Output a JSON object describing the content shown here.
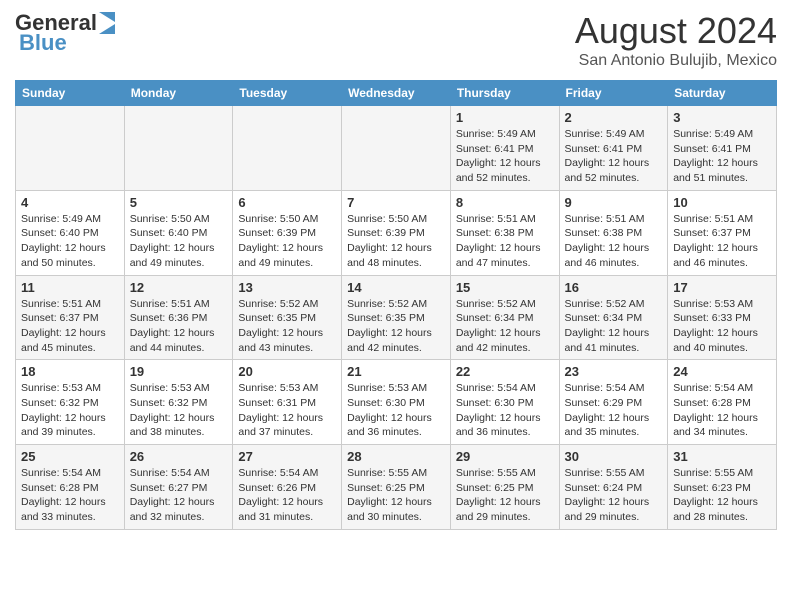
{
  "header": {
    "logo_text1": "General",
    "logo_text2": "Blue",
    "title": "August 2024",
    "subtitle": "San Antonio Bulujib, Mexico"
  },
  "days_of_week": [
    "Sunday",
    "Monday",
    "Tuesday",
    "Wednesday",
    "Thursday",
    "Friday",
    "Saturday"
  ],
  "weeks": [
    [
      {
        "day": "",
        "info": ""
      },
      {
        "day": "",
        "info": ""
      },
      {
        "day": "",
        "info": ""
      },
      {
        "day": "",
        "info": ""
      },
      {
        "day": "1",
        "info": "Sunrise: 5:49 AM\nSunset: 6:41 PM\nDaylight: 12 hours\nand 52 minutes."
      },
      {
        "day": "2",
        "info": "Sunrise: 5:49 AM\nSunset: 6:41 PM\nDaylight: 12 hours\nand 52 minutes."
      },
      {
        "day": "3",
        "info": "Sunrise: 5:49 AM\nSunset: 6:41 PM\nDaylight: 12 hours\nand 51 minutes."
      }
    ],
    [
      {
        "day": "4",
        "info": "Sunrise: 5:49 AM\nSunset: 6:40 PM\nDaylight: 12 hours\nand 50 minutes."
      },
      {
        "day": "5",
        "info": "Sunrise: 5:50 AM\nSunset: 6:40 PM\nDaylight: 12 hours\nand 49 minutes."
      },
      {
        "day": "6",
        "info": "Sunrise: 5:50 AM\nSunset: 6:39 PM\nDaylight: 12 hours\nand 49 minutes."
      },
      {
        "day": "7",
        "info": "Sunrise: 5:50 AM\nSunset: 6:39 PM\nDaylight: 12 hours\nand 48 minutes."
      },
      {
        "day": "8",
        "info": "Sunrise: 5:51 AM\nSunset: 6:38 PM\nDaylight: 12 hours\nand 47 minutes."
      },
      {
        "day": "9",
        "info": "Sunrise: 5:51 AM\nSunset: 6:38 PM\nDaylight: 12 hours\nand 46 minutes."
      },
      {
        "day": "10",
        "info": "Sunrise: 5:51 AM\nSunset: 6:37 PM\nDaylight: 12 hours\nand 46 minutes."
      }
    ],
    [
      {
        "day": "11",
        "info": "Sunrise: 5:51 AM\nSunset: 6:37 PM\nDaylight: 12 hours\nand 45 minutes."
      },
      {
        "day": "12",
        "info": "Sunrise: 5:51 AM\nSunset: 6:36 PM\nDaylight: 12 hours\nand 44 minutes."
      },
      {
        "day": "13",
        "info": "Sunrise: 5:52 AM\nSunset: 6:35 PM\nDaylight: 12 hours\nand 43 minutes."
      },
      {
        "day": "14",
        "info": "Sunrise: 5:52 AM\nSunset: 6:35 PM\nDaylight: 12 hours\nand 42 minutes."
      },
      {
        "day": "15",
        "info": "Sunrise: 5:52 AM\nSunset: 6:34 PM\nDaylight: 12 hours\nand 42 minutes."
      },
      {
        "day": "16",
        "info": "Sunrise: 5:52 AM\nSunset: 6:34 PM\nDaylight: 12 hours\nand 41 minutes."
      },
      {
        "day": "17",
        "info": "Sunrise: 5:53 AM\nSunset: 6:33 PM\nDaylight: 12 hours\nand 40 minutes."
      }
    ],
    [
      {
        "day": "18",
        "info": "Sunrise: 5:53 AM\nSunset: 6:32 PM\nDaylight: 12 hours\nand 39 minutes."
      },
      {
        "day": "19",
        "info": "Sunrise: 5:53 AM\nSunset: 6:32 PM\nDaylight: 12 hours\nand 38 minutes."
      },
      {
        "day": "20",
        "info": "Sunrise: 5:53 AM\nSunset: 6:31 PM\nDaylight: 12 hours\nand 37 minutes."
      },
      {
        "day": "21",
        "info": "Sunrise: 5:53 AM\nSunset: 6:30 PM\nDaylight: 12 hours\nand 36 minutes."
      },
      {
        "day": "22",
        "info": "Sunrise: 5:54 AM\nSunset: 6:30 PM\nDaylight: 12 hours\nand 36 minutes."
      },
      {
        "day": "23",
        "info": "Sunrise: 5:54 AM\nSunset: 6:29 PM\nDaylight: 12 hours\nand 35 minutes."
      },
      {
        "day": "24",
        "info": "Sunrise: 5:54 AM\nSunset: 6:28 PM\nDaylight: 12 hours\nand 34 minutes."
      }
    ],
    [
      {
        "day": "25",
        "info": "Sunrise: 5:54 AM\nSunset: 6:28 PM\nDaylight: 12 hours\nand 33 minutes."
      },
      {
        "day": "26",
        "info": "Sunrise: 5:54 AM\nSunset: 6:27 PM\nDaylight: 12 hours\nand 32 minutes."
      },
      {
        "day": "27",
        "info": "Sunrise: 5:54 AM\nSunset: 6:26 PM\nDaylight: 12 hours\nand 31 minutes."
      },
      {
        "day": "28",
        "info": "Sunrise: 5:55 AM\nSunset: 6:25 PM\nDaylight: 12 hours\nand 30 minutes."
      },
      {
        "day": "29",
        "info": "Sunrise: 5:55 AM\nSunset: 6:25 PM\nDaylight: 12 hours\nand 29 minutes."
      },
      {
        "day": "30",
        "info": "Sunrise: 5:55 AM\nSunset: 6:24 PM\nDaylight: 12 hours\nand 29 minutes."
      },
      {
        "day": "31",
        "info": "Sunrise: 5:55 AM\nSunset: 6:23 PM\nDaylight: 12 hours\nand 28 minutes."
      }
    ]
  ]
}
